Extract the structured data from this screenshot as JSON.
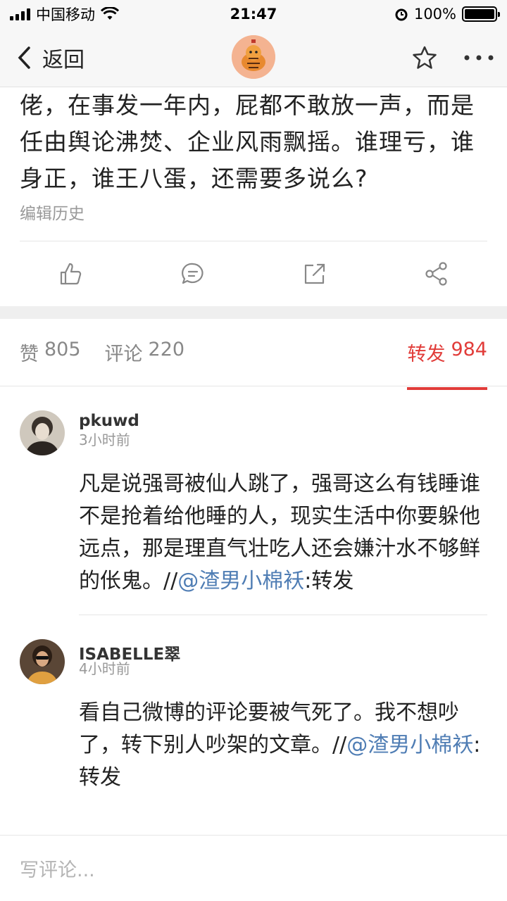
{
  "status_bar": {
    "carrier": "中国移动",
    "time": "21:47",
    "battery": "100%",
    "battery_level": 1.0
  },
  "nav": {
    "back_label": "返回",
    "icons": [
      "back-chevron-icon",
      "star-icon",
      "more-icon"
    ]
  },
  "post": {
    "text": "佬，在事发一年内，屁都不敢放一声，而是任由舆论沸焚、企业风雨飘摇。谁理亏，谁身正，谁王八蛋，还需要多说么?",
    "edit_history": "编辑历史",
    "actions": [
      "like-icon",
      "comment-icon",
      "repost-icon",
      "share-icon"
    ]
  },
  "tabs": [
    {
      "label": "赞",
      "count": "805"
    },
    {
      "label": "评论",
      "count": "220"
    },
    {
      "label": "转发",
      "count": "984",
      "active": true
    }
  ],
  "comments": [
    {
      "name": "pkuwd",
      "time": "3小时前",
      "text": "凡是说强哥被仙人跳了，强哥这么有钱睡谁不是抢着给他睡的人，现实生活中你要躲他远点，那是理直气壮吃人还会嫌汁水不够鲜的伥鬼。//",
      "mention": "@渣男小棉袄",
      "suffix": ":转发"
    },
    {
      "name": "ISABELLE翠",
      "time": "4小时前",
      "text": "看自己微博的评论要被气死了。我不想吵了，转下别人吵架的文章。//",
      "mention": "@渣男小棉袄",
      "suffix": ":转发"
    }
  ],
  "comment_input": {
    "placeholder": "写评论..."
  },
  "colors": {
    "accent": "#e13c39",
    "mention": "#4f7db4",
    "muted": "#999999"
  }
}
